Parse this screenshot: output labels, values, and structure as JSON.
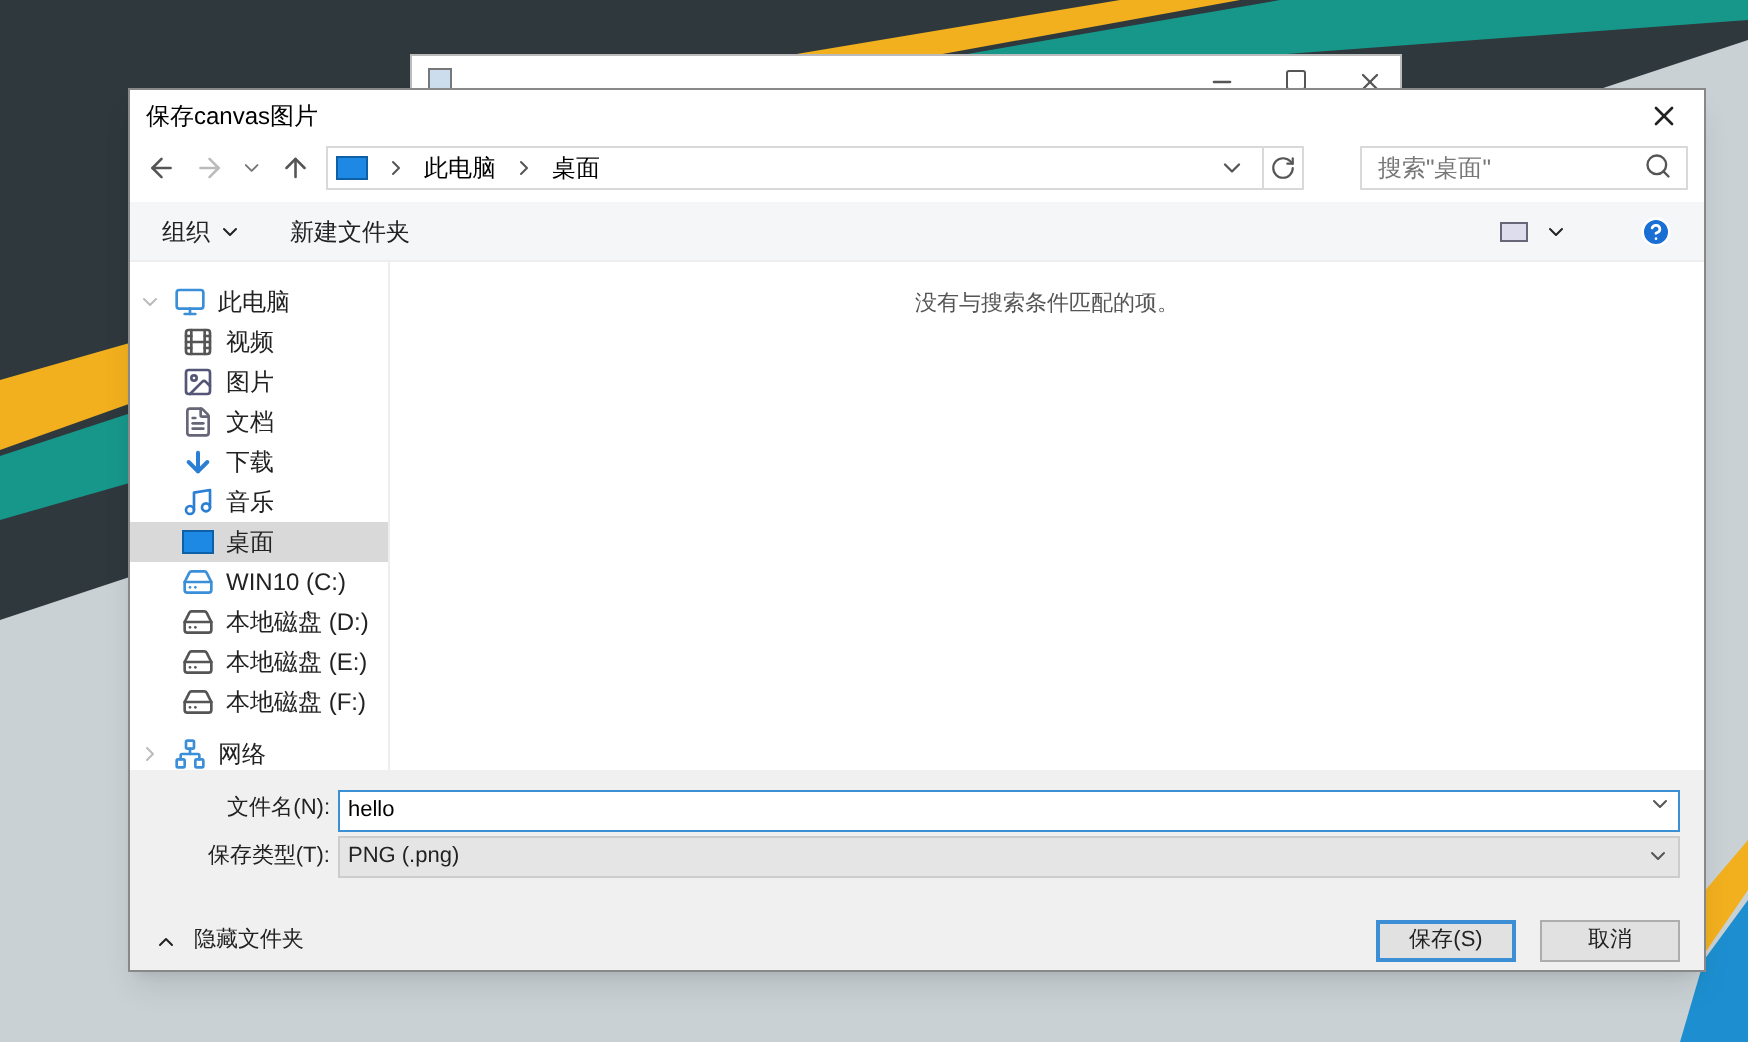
{
  "dialog": {
    "title": "保存canvas图片",
    "address": {
      "path": [
        "此电脑",
        "桌面"
      ]
    },
    "search": {
      "placeholder": "搜索\"桌面\""
    },
    "toolbar": {
      "organize": "组织",
      "new_folder": "新建文件夹"
    },
    "tree": [
      {
        "label": "此电脑",
        "kind": "pc",
        "expanded": true,
        "selected": false,
        "children": [
          {
            "label": "视频",
            "kind": "video",
            "selected": false
          },
          {
            "label": "图片",
            "kind": "picture",
            "selected": false
          },
          {
            "label": "文档",
            "kind": "document",
            "selected": false
          },
          {
            "label": "下载",
            "kind": "download",
            "selected": false
          },
          {
            "label": "音乐",
            "kind": "music",
            "selected": false
          },
          {
            "label": "桌面",
            "kind": "desktop",
            "selected": true
          },
          {
            "label": "WIN10 (C:)",
            "kind": "system-drive",
            "selected": false
          },
          {
            "label": "本地磁盘 (D:)",
            "kind": "drive",
            "selected": false
          },
          {
            "label": "本地磁盘 (E:)",
            "kind": "drive",
            "selected": false
          },
          {
            "label": "本地磁盘 (F:)",
            "kind": "drive",
            "selected": false
          }
        ]
      },
      {
        "label": "网络",
        "kind": "network",
        "expanded": false,
        "selected": false
      }
    ],
    "empty_message": "没有与搜索条件匹配的项。",
    "filename": {
      "label": "文件名(N):",
      "value": "hello"
    },
    "filetype": {
      "label": "保存类型(T):",
      "value": "PNG (.png)"
    },
    "hide_folders": "隐藏文件夹",
    "buttons": [
      {
        "label": "保存(S)",
        "kind": "primary"
      },
      {
        "label": "取消",
        "kind": "normal"
      }
    ]
  }
}
